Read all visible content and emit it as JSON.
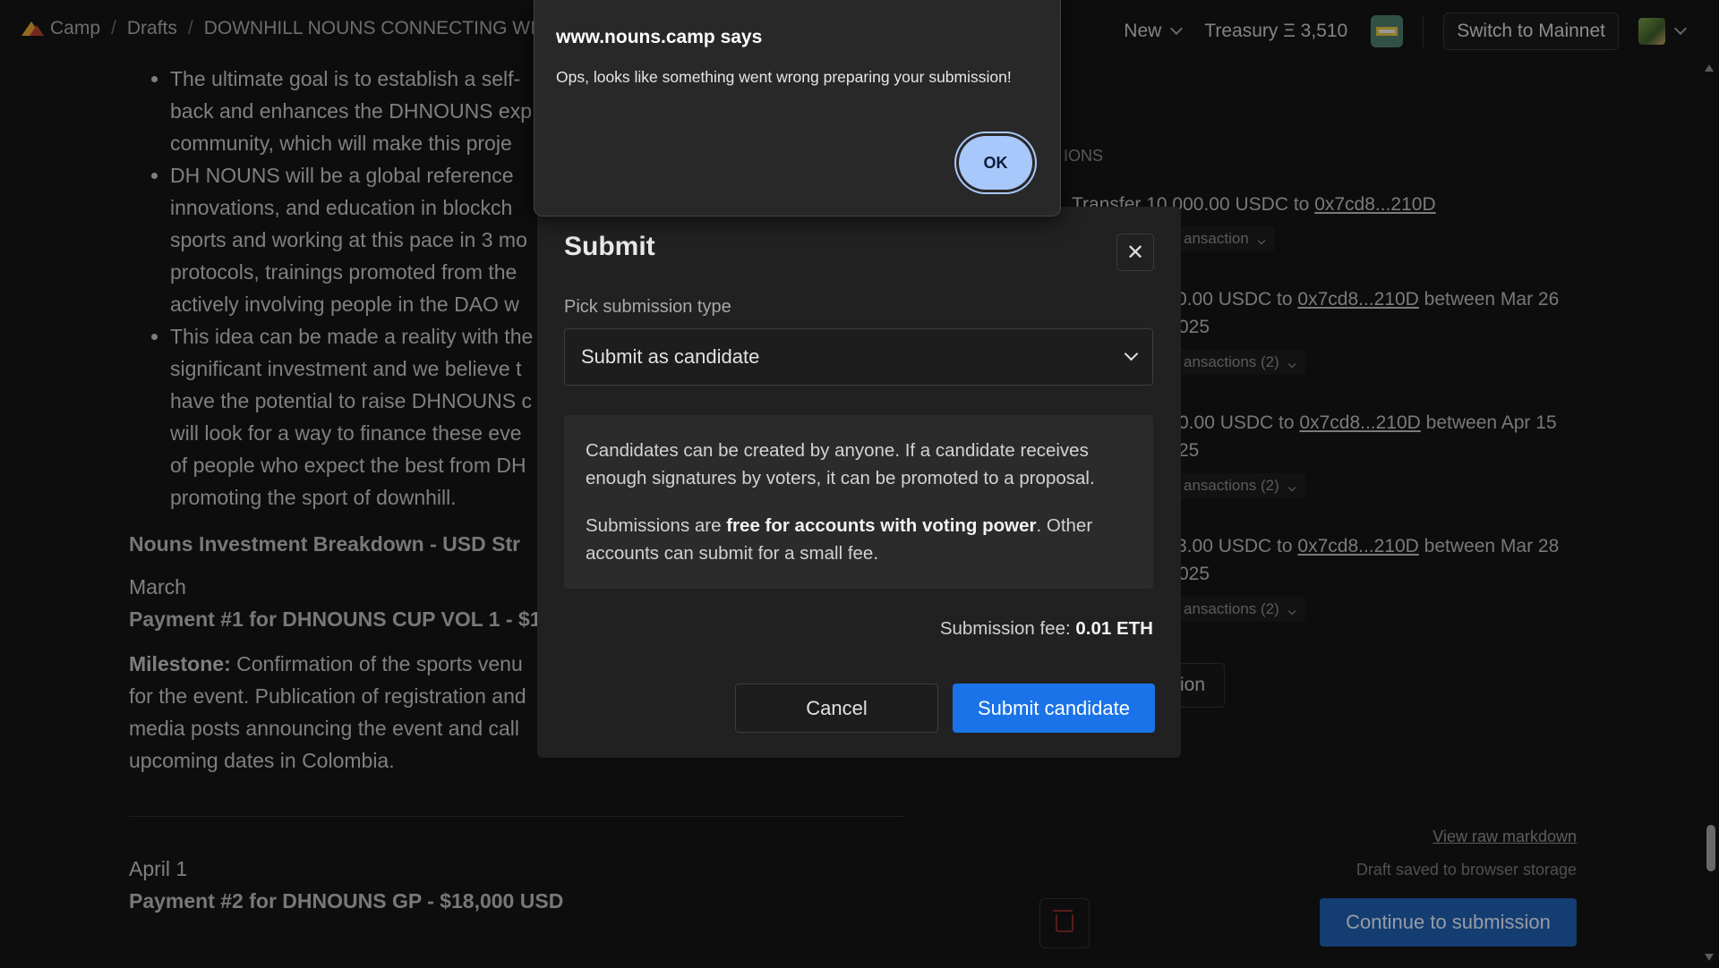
{
  "header": {
    "breadcrumbs": [
      "Camp",
      "Drafts",
      "DOWNHILL NOUNS CONNECTING WIT"
    ],
    "new_label": "New",
    "treasury_label": "Treasury Ξ 3,510",
    "switch_network_label": "Switch to Mainnet"
  },
  "article": {
    "bullets": [
      [
        "The ultimate goal is to establish a self-",
        "back and enhances the DHNOUNS exp",
        "community, which will make this proje"
      ],
      [
        "DH NOUNS will be a global reference",
        "innovations, and education in blockch",
        "sports and working at this pace in 3 mo",
        "protocols, trainings promoted from the",
        "actively involving people in the DAO w"
      ],
      [
        "This idea can be made a reality with the",
        "significant investment and we believe t",
        "have the potential to raise DHNOUNS c",
        "will look for a way to finance these eve",
        "of people who expect the best from DH",
        "promoting the sport of downhill."
      ]
    ],
    "section_title": "Nouns Investment Breakdown  - USD Str",
    "month_1": "March",
    "payment_1": "Payment #1 for DHNOUNS CUP VOL 1 - $1",
    "milestone_label": "Milestone:",
    "milestone_lines": [
      " Confirmation of the sports venu",
      "for the event. Publication of registration and",
      "media posts announcing the event and call",
      "upcoming dates in Colombia."
    ],
    "month_2": "April 1",
    "payment_2": "Payment #2 for DHNOUNS GP - $18,000 USD"
  },
  "right_panel": {
    "actions_heading_fragment": "IONS",
    "tx1_text": "Transfer 10,000.00 USDC to",
    "address": "0x7cd8...210D",
    "tx1_toggle": "ansaction",
    "tx2_text": "0.00 USDC to",
    "tx2_between": " between Mar 26",
    "tx2_year": "025",
    "tx2_toggle": "ansactions (2)",
    "tx3_text": "0.00 USDC to",
    "tx3_between": " between Apr 15",
    "tx3_year": "25",
    "tx3_toggle": "ansactions (2)",
    "tx4_text": "3.00 USDC to",
    "tx4_between": " between Mar 28",
    "tx4_year": "025",
    "tx4_toggle": "ansactions (2)",
    "partial_button": "ion",
    "view_raw_markdown": "View raw markdown",
    "draft_saved": "Draft saved to browser storage",
    "continue_label": "Continue to submission"
  },
  "modal": {
    "title": "Submit",
    "close_glyph": "✕",
    "pick_label": "Pick submission type",
    "selected_type": "Submit as candidate",
    "info_p1": "Candidates can be created by anyone. If a candidate receives enough signatures by voters, it can be promoted to a proposal.",
    "info_p2_prefix": "Submissions are ",
    "info_p2_bold": "free for accounts with voting power",
    "info_p2_suffix": ". Other accounts can submit for a small fee.",
    "fee_label": "Submission fee: ",
    "fee_value": "0.01 ETH",
    "cancel_label": "Cancel",
    "submit_label": "Submit candidate"
  },
  "alert": {
    "title": "www.nouns.camp says",
    "message": "Ops, looks like something went wrong preparing your submission!",
    "ok_label": "OK"
  },
  "colors": {
    "background": "#141414",
    "modal_bg": "#212121",
    "primary_button": "#1a73e8",
    "continue_button": "#1f5fb0",
    "alert_ok": "#a8c7fa"
  }
}
